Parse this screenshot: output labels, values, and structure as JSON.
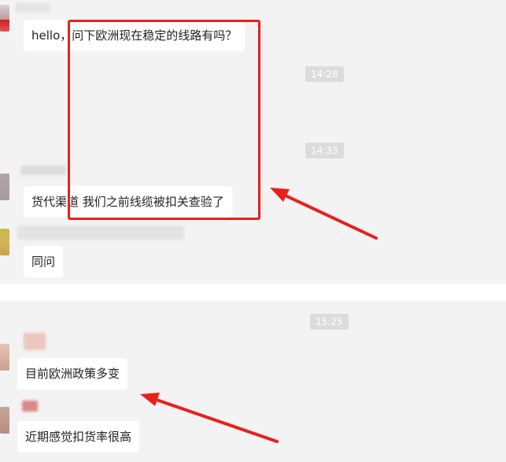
{
  "chat": {
    "messages": [
      {
        "text": "hello，问下欧洲现在稳定的线路有吗？"
      },
      {
        "text": "货代渠道 我们之前线缆被扣关查验了"
      },
      {
        "text": "同问"
      },
      {
        "text": "目前欧洲政策多变"
      },
      {
        "text": "近期感觉扣货率很高"
      }
    ],
    "timestamps": [
      "14:28",
      "14:33",
      "15:25"
    ]
  },
  "colors": {
    "panel_background": "#f3f3f3",
    "bubble_background": "#ffffff",
    "timestamp_background": "#dcdcdc",
    "annotation_red": "#e8201c"
  }
}
